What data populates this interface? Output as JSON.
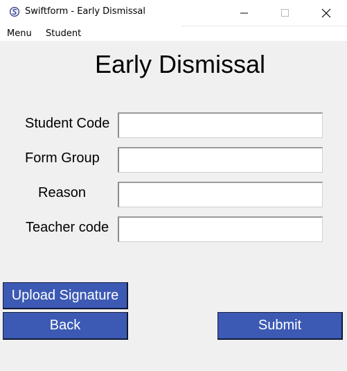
{
  "window": {
    "title": "Swiftform - Early Dismissal",
    "icon": "swiftform-logo-icon",
    "controls": [
      "minimize",
      "maximize",
      "close"
    ]
  },
  "menubar": {
    "items": [
      {
        "label": "Menu"
      },
      {
        "label": "Student"
      }
    ]
  },
  "form": {
    "heading": "Early Dismissal",
    "fields": [
      {
        "label": "Student Code",
        "value": ""
      },
      {
        "label": "Form Group",
        "value": ""
      },
      {
        "label": "Reason",
        "value": ""
      },
      {
        "label": "Teacher code",
        "value": ""
      }
    ]
  },
  "buttons": {
    "upload_signature": "Upload Signature",
    "back": "Back",
    "submit": "Submit"
  },
  "colors": {
    "button_bg": "#3c5ab4",
    "button_text": "#ffffff",
    "window_bg": "#f0f0f0"
  }
}
